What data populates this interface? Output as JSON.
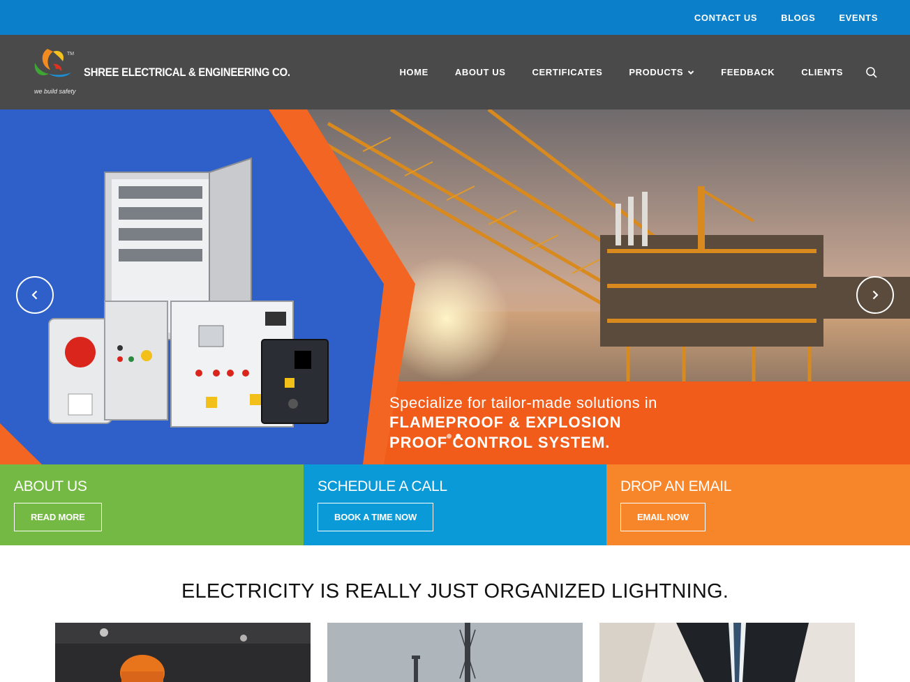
{
  "topbar": {
    "links": [
      "CONTACT US",
      "BLOGS",
      "EVENTS"
    ]
  },
  "header": {
    "logo": {
      "name": "SHREE ELECTRICAL & ENGINEERING CO.",
      "tagline": "we build safety",
      "tm": "TM"
    },
    "nav": [
      "HOME",
      "ABOUT US",
      "CERTIFICATES",
      "PRODUCTS",
      "FEEDBACK",
      "CLIENTS"
    ]
  },
  "hero": {
    "caption_line1": "Specialize for tailor-made solutions in",
    "caption_line2": "FLAMEPROOF & EXPLOSION",
    "caption_line3": "PROOF CONTROL SYSTEM.",
    "active_slide": 2,
    "slide_count": 2
  },
  "cta": [
    {
      "title": "ABOUT US",
      "button": "READ MORE",
      "color": "#74b944"
    },
    {
      "title": "SCHEDULE A CALL",
      "button": "BOOK A TIME NOW",
      "color": "#0b9ad8"
    },
    {
      "title": "DROP AN EMAIL",
      "button": "EMAIL NOW",
      "color": "#f7862a"
    }
  ],
  "quote": "ELECTRICITY IS REALLY JUST ORGANIZED LIGHTNING.",
  "colors": {
    "topbar": "#0b7fc9",
    "header": "#4a4a4a",
    "accent_orange": "#f26522",
    "accent_blue": "#2f5fc8"
  },
  "icons": [
    "search-icon",
    "chevron-down-icon",
    "chevron-left-icon",
    "chevron-right-icon"
  ]
}
